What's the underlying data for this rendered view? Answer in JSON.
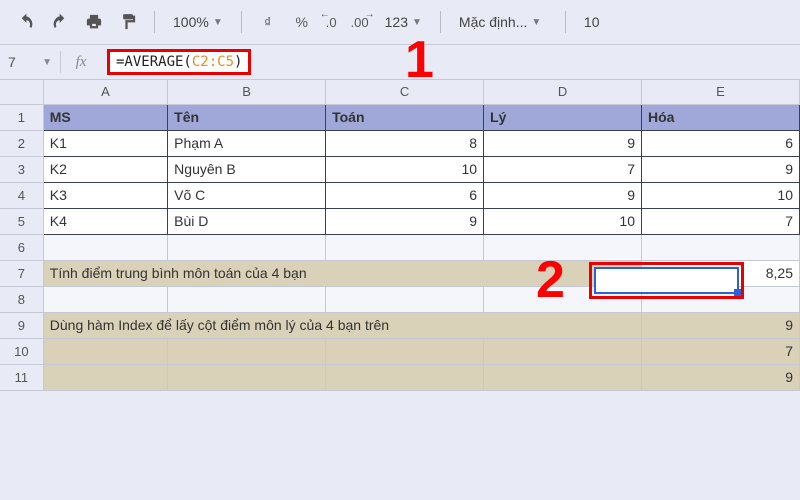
{
  "toolbar": {
    "zoom": "100%",
    "currency": "₫",
    "percent": "%",
    "dec_dec": ".0",
    "dec_inc": ".00",
    "num_format": "123",
    "font": "Mặc định...",
    "font_size": "10"
  },
  "formula_bar": {
    "namebox": "7",
    "fx": "fx",
    "prefix": "=AVERAGE(",
    "range": "C2:C5",
    "suffix": ")"
  },
  "columns": [
    "A",
    "B",
    "C",
    "D",
    "E"
  ],
  "rows": [
    "1",
    "2",
    "3",
    "4",
    "5",
    "6",
    "7",
    "8",
    "9",
    "10",
    "11"
  ],
  "header": {
    "A": "MS",
    "B": "Tên",
    "C": "Toán",
    "D": "Lý",
    "E": "Hóa"
  },
  "data": [
    {
      "A": "K1",
      "B": "Phạm A",
      "C": "8",
      "D": "9",
      "E": "6"
    },
    {
      "A": "K2",
      "B": "Nguyên B",
      "C": "10",
      "D": "7",
      "E": "9"
    },
    {
      "A": "K3",
      "B": "Võ C",
      "C": "6",
      "D": "9",
      "E": "10"
    },
    {
      "A": "K4",
      "B": "Bùi D",
      "C": "9",
      "D": "10",
      "E": "7"
    }
  ],
  "row7": {
    "text": "Tính điểm trung bình môn toán của 4 bạn",
    "result": "8,25"
  },
  "row9": {
    "text": "Dùng hàm Index để lấy cột điểm môn lý của 4 bạn trên",
    "E": "9"
  },
  "row10": {
    "E": "7"
  },
  "row11": {
    "E": "9"
  },
  "annotations": {
    "one": "1",
    "two": "2"
  },
  "chart_data": {
    "type": "table",
    "title": "",
    "columns": [
      "MS",
      "Tên",
      "Toán",
      "Lý",
      "Hóa"
    ],
    "rows": [
      [
        "K1",
        "Phạm A",
        8,
        9,
        6
      ],
      [
        "K2",
        "Nguyên B",
        10,
        7,
        9
      ],
      [
        "K3",
        "Võ C",
        6,
        9,
        10
      ],
      [
        "K4",
        "Bùi D",
        9,
        10,
        7
      ]
    ],
    "computed": {
      "label": "Tính điểm trung bình môn toán của 4 bạn",
      "formula": "=AVERAGE(C2:C5)",
      "value": 8.25
    }
  }
}
